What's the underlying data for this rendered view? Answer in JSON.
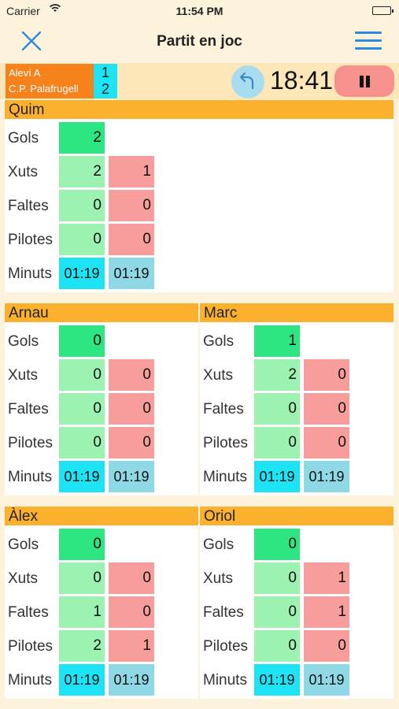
{
  "status": {
    "carrier": "Carrier",
    "time": "11:54 PM"
  },
  "nav": {
    "title": "Partit en joc"
  },
  "match": {
    "team_home": "Aleví A",
    "team_away": "C.P. Palafrugell",
    "score_home": "1",
    "score_away": "2",
    "clock": "18:41"
  },
  "row_labels": {
    "goals": "Gols",
    "shots": "Xuts",
    "fouls": "Faltes",
    "balls": "Pilotes",
    "minutes": "Minuts"
  },
  "players": [
    {
      "name": "Quim",
      "goals": "2",
      "shots": [
        "2",
        "1"
      ],
      "fouls": [
        "0",
        "0"
      ],
      "balls": [
        "0",
        "0"
      ],
      "minutes": [
        "01:19",
        "01:19"
      ]
    },
    {
      "name": "Arnau",
      "goals": "0",
      "shots": [
        "0",
        "0"
      ],
      "fouls": [
        "0",
        "0"
      ],
      "balls": [
        "0",
        "0"
      ],
      "minutes": [
        "01:19",
        "01:19"
      ]
    },
    {
      "name": "Marc",
      "goals": "1",
      "shots": [
        "2",
        "0"
      ],
      "fouls": [
        "0",
        "0"
      ],
      "balls": [
        "0",
        "0"
      ],
      "minutes": [
        "01:19",
        "01:19"
      ]
    },
    {
      "name": "Àlex",
      "goals": "0",
      "shots": [
        "0",
        "0"
      ],
      "fouls": [
        "1",
        "0"
      ],
      "balls": [
        "2",
        "1"
      ],
      "minutes": [
        "01:19",
        "01:19"
      ]
    },
    {
      "name": "Oriol",
      "goals": "0",
      "shots": [
        "0",
        "1"
      ],
      "fouls": [
        "0",
        "1"
      ],
      "balls": [
        "0",
        "0"
      ],
      "minutes": [
        "01:19",
        "01:19"
      ]
    }
  ],
  "colors": {
    "accent": "#2b8be0",
    "header": "#fbb12e",
    "goals": "#2de681",
    "positive": "#9bf2b1",
    "negative": "#f79e9c",
    "minutes_on": "#1de4f5",
    "minutes_total": "#8fd9e6"
  }
}
